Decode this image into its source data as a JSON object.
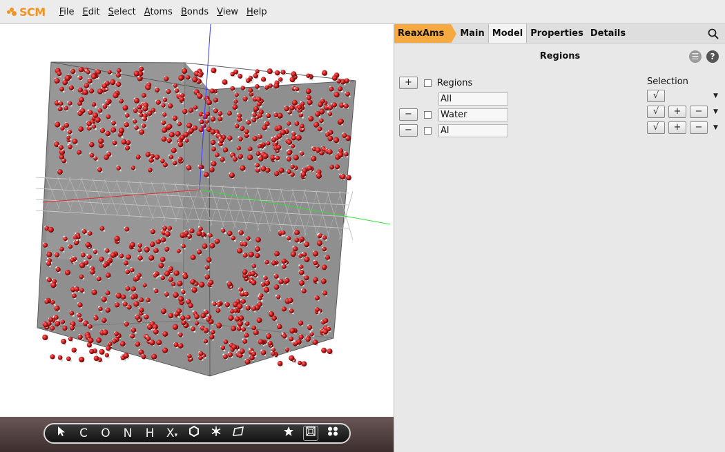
{
  "app": {
    "logo_text": "SCM",
    "brand_color": "#f29320"
  },
  "menu": [
    {
      "label": "File",
      "key": "F",
      "rest": "ile"
    },
    {
      "label": "Edit",
      "key": "E",
      "rest": "dit"
    },
    {
      "label": "Select",
      "key": "S",
      "rest": "elect"
    },
    {
      "label": "Atoms",
      "key": "A",
      "rest": "toms"
    },
    {
      "label": "Bonds",
      "key": "B",
      "rest": "onds"
    },
    {
      "label": "View",
      "key": "V",
      "rest": "iew"
    },
    {
      "label": "Help",
      "key": "H",
      "rest": "elp"
    }
  ],
  "tabs": {
    "engine": "ReaxAms",
    "items": [
      "Main",
      "Model",
      "Properties",
      "Details"
    ],
    "active": "Model"
  },
  "regions": {
    "title": "Regions",
    "header_label": "Regions",
    "selection_label": "Selection",
    "rows": [
      {
        "name": "All"
      },
      {
        "name": "Water"
      },
      {
        "name": "Al"
      }
    ],
    "add_label": "+",
    "remove_label": "−",
    "check_label": "√",
    "plus_label": "+",
    "minus_label": "−",
    "menu_icon_label": "☰",
    "help_label": "?"
  },
  "toolbar": {
    "tools": [
      "C",
      "O",
      "N",
      "H",
      "X"
    ],
    "x_suffix": "▾"
  }
}
